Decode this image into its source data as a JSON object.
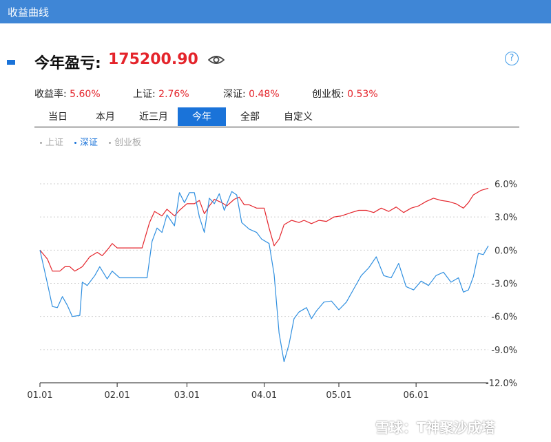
{
  "window": {
    "title": "收益曲线"
  },
  "summary": {
    "label": "今年盈亏:",
    "value": "175200.90"
  },
  "stats": [
    {
      "label": "收益率:",
      "value": "5.60%"
    },
    {
      "label": "上证:",
      "value": "2.76%"
    },
    {
      "label": "深证:",
      "value": "0.48%"
    },
    {
      "label": "创业板:",
      "value": "0.53%"
    }
  ],
  "tabs": [
    {
      "label": "当日",
      "active": false
    },
    {
      "label": "本月",
      "active": false
    },
    {
      "label": "近三月",
      "active": false
    },
    {
      "label": "今年",
      "active": true
    },
    {
      "label": "全部",
      "active": false
    },
    {
      "label": "自定义",
      "active": false
    }
  ],
  "legend": [
    {
      "label": "上证",
      "color": "#a6a6a6",
      "active": false
    },
    {
      "label": "深证",
      "color": "#1a73d9",
      "active": true
    },
    {
      "label": "创业板",
      "color": "#a6a6a6",
      "active": false
    }
  ],
  "help_icon": "?",
  "watermark": "雪球：T神聚沙成塔",
  "colors": {
    "portfolio": "#e4242b",
    "index": "#2f8fe0",
    "accent": "#1a73d9"
  },
  "chart_data": {
    "type": "line",
    "x_ticks": [
      "01.01",
      "02.01",
      "03.01",
      "04.01",
      "05.01",
      "06.01"
    ],
    "y_ticks": [
      "6.0%",
      "3.0%",
      "0.0%",
      "-3.0%",
      "-6.0%",
      "-9.0%",
      "-12.0%"
    ],
    "ylim": [
      -12,
      6
    ],
    "grid": true,
    "xlim": [
      "01.01",
      "06.30"
    ],
    "series": [
      {
        "color": "#e4242b",
        "points": [
          [
            "01.01",
            0.0
          ],
          [
            "01.04",
            -0.8
          ],
          [
            "01.06",
            -1.9
          ],
          [
            "01.09",
            -1.9
          ],
          [
            "01.11",
            -1.5
          ],
          [
            "01.13",
            -1.5
          ],
          [
            "01.15",
            -1.9
          ],
          [
            "01.18",
            -1.5
          ],
          [
            "01.21",
            -0.6
          ],
          [
            "01.24",
            -0.2
          ],
          [
            "01.26",
            -0.5
          ],
          [
            "01.28",
            0.0
          ],
          [
            "01.30",
            0.6
          ],
          [
            "02.01",
            0.2
          ],
          [
            "02.04",
            0.2
          ],
          [
            "02.08",
            0.2
          ],
          [
            "02.11",
            0.2
          ],
          [
            "02.14",
            2.5
          ],
          [
            "02.16",
            3.5
          ],
          [
            "02.19",
            3.1
          ],
          [
            "02.21",
            3.7
          ],
          [
            "02.24",
            3.1
          ],
          [
            "02.26",
            3.6
          ],
          [
            "03.01",
            4.2
          ],
          [
            "03.04",
            4.2
          ],
          [
            "03.06",
            4.5
          ],
          [
            "03.08",
            3.3
          ],
          [
            "03.10",
            4.0
          ],
          [
            "03.12",
            4.6
          ],
          [
            "03.15",
            4.3
          ],
          [
            "03.17",
            4.0
          ],
          [
            "03.20",
            4.6
          ],
          [
            "03.22",
            4.8
          ],
          [
            "03.24",
            4.1
          ],
          [
            "03.26",
            4.1
          ],
          [
            "03.29",
            3.8
          ],
          [
            "04.01",
            3.8
          ],
          [
            "04.03",
            2.0
          ],
          [
            "04.05",
            0.4
          ],
          [
            "04.07",
            1.0
          ],
          [
            "04.09",
            2.3
          ],
          [
            "04.12",
            2.7
          ],
          [
            "04.15",
            2.5
          ],
          [
            "04.17",
            2.7
          ],
          [
            "04.20",
            2.4
          ],
          [
            "04.23",
            2.7
          ],
          [
            "04.26",
            2.6
          ],
          [
            "04.29",
            3.0
          ],
          [
            "05.02",
            3.1
          ],
          [
            "05.06",
            3.4
          ],
          [
            "05.09",
            3.6
          ],
          [
            "05.12",
            3.6
          ],
          [
            "05.15",
            3.4
          ],
          [
            "05.18",
            3.8
          ],
          [
            "05.21",
            3.5
          ],
          [
            "05.24",
            3.9
          ],
          [
            "05.27",
            3.4
          ],
          [
            "05.30",
            3.8
          ],
          [
            "06.02",
            4.0
          ],
          [
            "06.05",
            4.4
          ],
          [
            "06.08",
            4.7
          ],
          [
            "06.11",
            4.5
          ],
          [
            "06.14",
            4.4
          ],
          [
            "06.17",
            4.2
          ],
          [
            "06.20",
            3.8
          ],
          [
            "06.22",
            4.3
          ],
          [
            "06.24",
            5.0
          ],
          [
            "06.27",
            5.4
          ],
          [
            "06.30",
            5.6
          ]
        ]
      },
      {
        "color": "#2f8fe0",
        "points": [
          [
            "01.01",
            0.0
          ],
          [
            "01.04",
            -3.0
          ],
          [
            "01.06",
            -5.1
          ],
          [
            "01.08",
            -5.2
          ],
          [
            "01.10",
            -4.2
          ],
          [
            "01.12",
            -5.0
          ],
          [
            "01.14",
            -6.0
          ],
          [
            "01.17",
            -5.9
          ],
          [
            "01.18",
            -2.9
          ],
          [
            "01.20",
            -3.2
          ],
          [
            "01.23",
            -2.3
          ],
          [
            "01.25",
            -1.5
          ],
          [
            "01.28",
            -2.6
          ],
          [
            "01.30",
            -1.9
          ],
          [
            "02.02",
            -2.5
          ],
          [
            "02.05",
            -2.5
          ],
          [
            "02.09",
            -2.5
          ],
          [
            "02.13",
            -2.5
          ],
          [
            "02.15",
            0.8
          ],
          [
            "02.17",
            2.0
          ],
          [
            "02.19",
            1.6
          ],
          [
            "02.21",
            3.2
          ],
          [
            "02.24",
            2.2
          ],
          [
            "02.26",
            5.2
          ],
          [
            "02.28",
            4.3
          ],
          [
            "03.02",
            5.2
          ],
          [
            "03.04",
            5.2
          ],
          [
            "03.06",
            3.0
          ],
          [
            "03.08",
            1.6
          ],
          [
            "03.10",
            4.7
          ],
          [
            "03.12",
            4.2
          ],
          [
            "03.14",
            5.1
          ],
          [
            "03.16",
            3.6
          ],
          [
            "03.19",
            5.3
          ],
          [
            "03.21",
            5.0
          ],
          [
            "03.23",
            2.5
          ],
          [
            "03.26",
            1.9
          ],
          [
            "03.29",
            1.6
          ],
          [
            "03.31",
            1.0
          ],
          [
            "04.03",
            0.6
          ],
          [
            "04.05",
            -2.2
          ],
          [
            "04.07",
            -7.5
          ],
          [
            "04.09",
            -10.1
          ],
          [
            "04.11",
            -8.5
          ],
          [
            "04.13",
            -6.2
          ],
          [
            "04.15",
            -5.6
          ],
          [
            "04.18",
            -5.2
          ],
          [
            "04.20",
            -6.2
          ],
          [
            "04.22",
            -5.5
          ],
          [
            "04.25",
            -4.7
          ],
          [
            "04.28",
            -4.6
          ],
          [
            "05.01",
            -5.4
          ],
          [
            "05.04",
            -4.7
          ],
          [
            "05.07",
            -3.5
          ],
          [
            "05.10",
            -2.3
          ],
          [
            "05.13",
            -1.6
          ],
          [
            "05.16",
            -0.6
          ],
          [
            "05.19",
            -2.3
          ],
          [
            "05.22",
            -2.5
          ],
          [
            "05.25",
            -1.2
          ],
          [
            "05.28",
            -3.3
          ],
          [
            "05.31",
            -3.6
          ],
          [
            "06.03",
            -2.8
          ],
          [
            "06.06",
            -3.2
          ],
          [
            "06.09",
            -2.3
          ],
          [
            "06.12",
            -2.0
          ],
          [
            "06.15",
            -2.9
          ],
          [
            "06.18",
            -2.5
          ],
          [
            "06.20",
            -3.8
          ],
          [
            "06.22",
            -3.6
          ],
          [
            "06.24",
            -2.4
          ],
          [
            "06.26",
            -0.3
          ],
          [
            "06.28",
            -0.4
          ],
          [
            "06.30",
            0.4
          ]
        ]
      }
    ]
  }
}
